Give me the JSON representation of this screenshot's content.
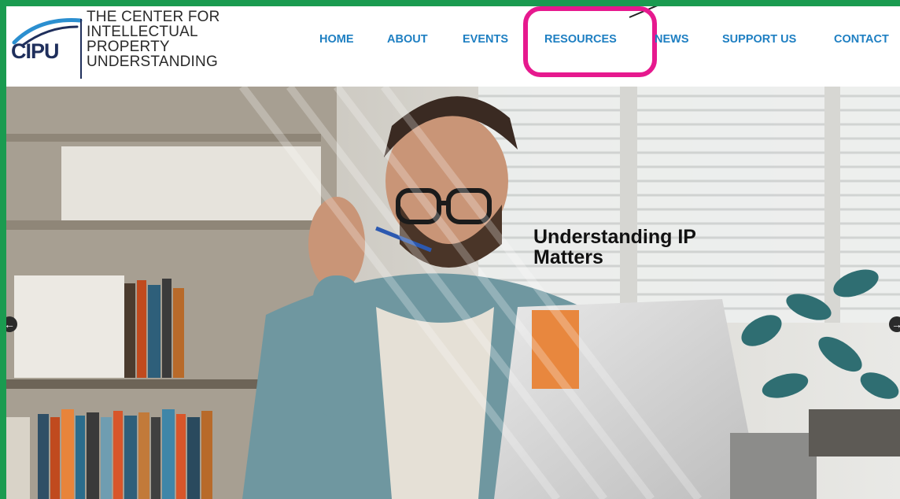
{
  "brand": {
    "mark": "CIPU",
    "lines": [
      "THE CENTER FOR",
      "INTELLECTUAL",
      "PROPERTY",
      "UNDERSTANDING"
    ],
    "colors": {
      "navy": "#1f2f5c",
      "sky": "#2b8fd0"
    }
  },
  "nav": {
    "items": [
      {
        "label": "HOME"
      },
      {
        "label": "ABOUT"
      },
      {
        "label": "EVENTS"
      },
      {
        "label": "RESOURCES"
      },
      {
        "label": "NEWS"
      },
      {
        "label": "SUPPORT US"
      },
      {
        "label": "CONTACT"
      }
    ],
    "color": "#1e7fc2",
    "highlight_color": "#e6198e",
    "highlighted": "RESOURCES"
  },
  "hero": {
    "headline_line1": "Understanding IP",
    "headline_line2": "Matters",
    "prev_icon": "arrow-left-icon",
    "next_icon": "arrow-right-icon"
  },
  "frame_color": "#1a9b50"
}
